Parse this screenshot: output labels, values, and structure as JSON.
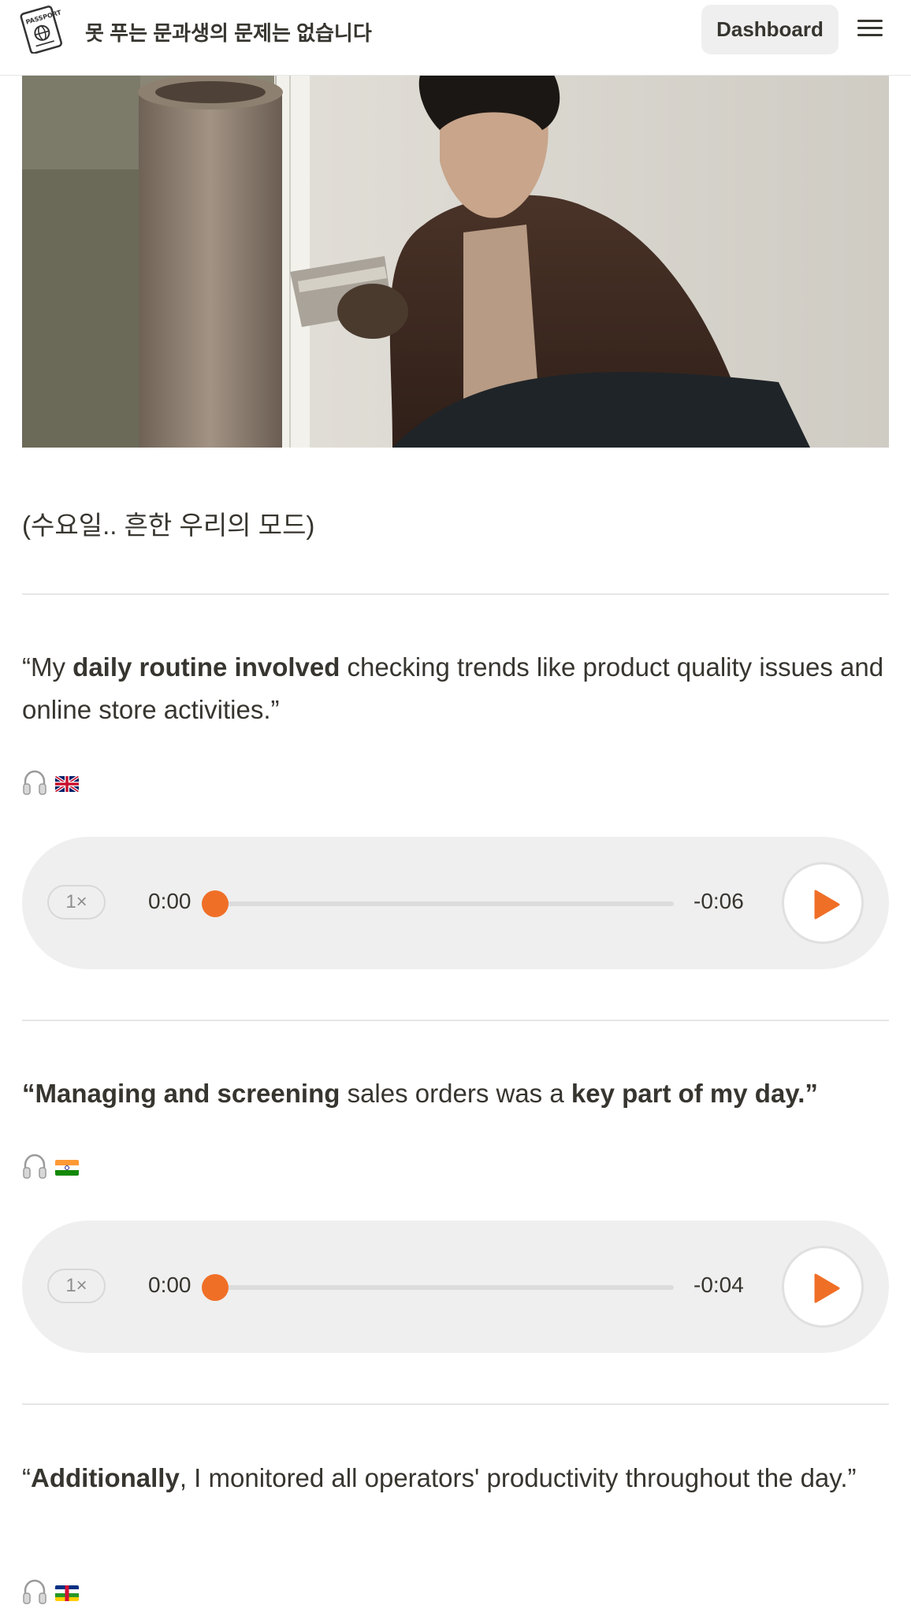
{
  "header": {
    "title": "못 푸는 문과생의 문제는 없습니다",
    "dashboard_label": "Dashboard",
    "logo_icon": "passport-icon",
    "logo_text": "PASSPORT",
    "menu_icon": "hamburger-menu-icon"
  },
  "photo": {
    "caption": "(수요일.. 흔한 우리의 모드)"
  },
  "entries": [
    {
      "quote_parts": [
        "“My ",
        "daily routine involved",
        " checking trends like product quality issues and online store activities.”"
      ],
      "audio_icon": "headphones-icon",
      "flag": "uk-flag",
      "player": {
        "speed": "1×",
        "current": "0:00",
        "remaining": "-0:06",
        "progress": 0
      }
    },
    {
      "quote_parts": [
        "“Managing and screening",
        " sales orders was a ",
        "key part of my day.”"
      ],
      "audio_icon": "headphones-icon",
      "flag": "india-flag",
      "player": {
        "speed": "1×",
        "current": "0:00",
        "remaining": "-0:04",
        "progress": 0
      }
    },
    {
      "quote_parts": [
        "“",
        "Additionally",
        ", I monitored all operators' productivity throughout the day.”"
      ],
      "audio_icon": "headphones-icon",
      "flag": "central-african-republic-flag"
    }
  ],
  "colors": {
    "accent": "#f06f27",
    "text": "#37352f",
    "player_bg": "#efefef",
    "divider": "#e6e6e6"
  }
}
